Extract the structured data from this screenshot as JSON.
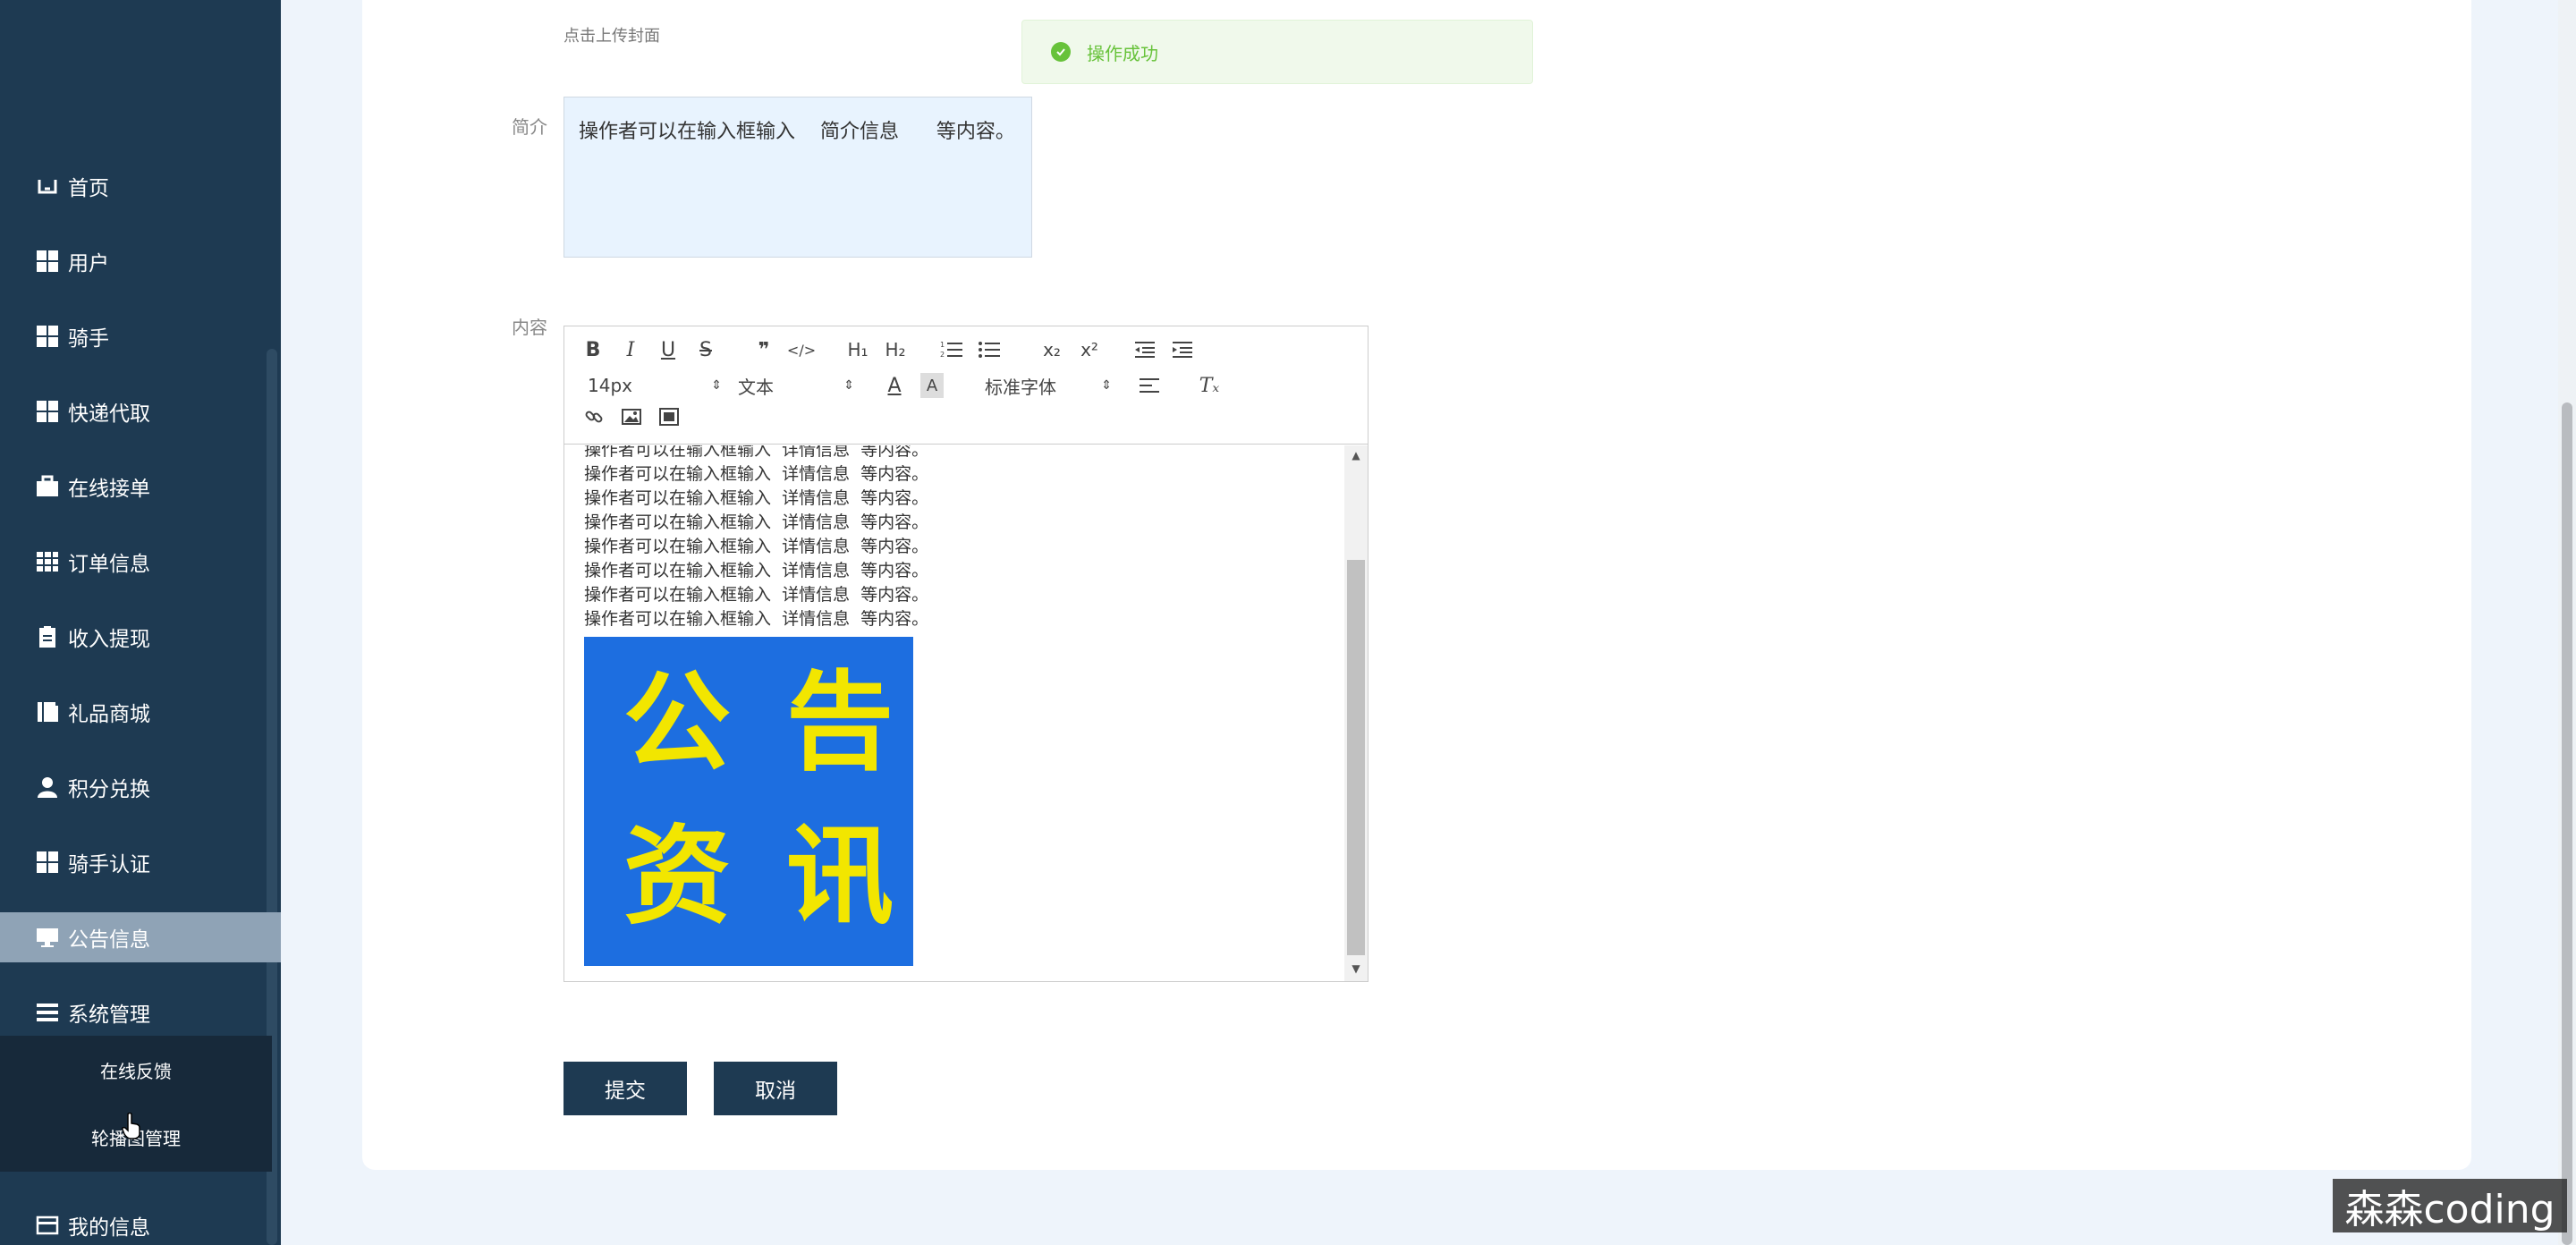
{
  "sidebar": {
    "menu": [
      {
        "label": "首页",
        "icon": "home-icon"
      },
      {
        "label": "用户",
        "icon": "grid-icon"
      },
      {
        "label": "骑手",
        "icon": "grid-icon"
      },
      {
        "label": "快递代取",
        "icon": "grid-icon"
      },
      {
        "label": "在线接单",
        "icon": "briefcase-icon"
      },
      {
        "label": "订单信息",
        "icon": "table-icon"
      },
      {
        "label": "收入提现",
        "icon": "clipboard-icon"
      },
      {
        "label": "礼品商城",
        "icon": "book-icon"
      },
      {
        "label": "积分兑换",
        "icon": "user-icon"
      },
      {
        "label": "骑手认证",
        "icon": "grid-icon"
      },
      {
        "label": "公告信息",
        "icon": "monitor-icon"
      },
      {
        "label": "系统管理",
        "icon": "list-icon"
      }
    ],
    "active_item": "公告信息",
    "submenu": [
      {
        "label": "在线反馈"
      },
      {
        "label": "轮播图管理"
      }
    ],
    "bottom_item": {
      "label": "我的信息",
      "icon": "card-icon"
    }
  },
  "form": {
    "upload_hint": "点击上传封面",
    "intro_label": "简介",
    "intro_value": "操作者可以在输入框输入    简介信息      等内容。",
    "content_label": "内容",
    "editor": {
      "font_size": "14px",
      "header_select": "文本",
      "font_family": "标准字体",
      "lines": [
        "操作者可以在输入框输入  详情信息  等内容。",
        "操作者可以在输入框输入  详情信息  等内容。",
        "操作者可以在输入框输入  详情信息  等内容。",
        "操作者可以在输入框输入  详情信息  等内容。",
        "操作者可以在输入框输入  详情信息  等内容。",
        "操作者可以在输入框输入  详情信息  等内容。",
        "操作者可以在输入框输入  详情信息  等内容。",
        "操作者可以在输入框输入  详情信息  等内容。"
      ],
      "image_chars": [
        "公",
        "告",
        "资",
        "讯"
      ]
    },
    "submit_label": "提交",
    "cancel_label": "取消"
  },
  "toast": {
    "message": "操作成功",
    "color": "#67c23a"
  },
  "watermark": "森森coding",
  "colors": {
    "sidebar": "#1e3a52",
    "active": "#8fa3b6",
    "button": "#1e3a52",
    "image_bg": "#1d6ee0",
    "image_text": "#f2e600"
  }
}
